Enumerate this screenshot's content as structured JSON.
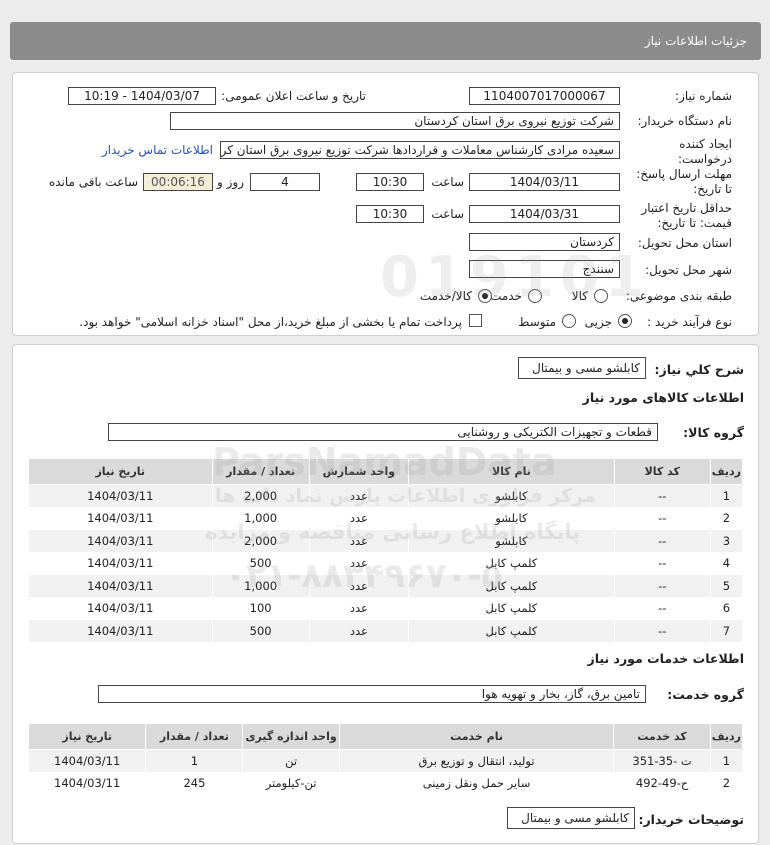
{
  "header": {
    "title": "جزئیات اطلاعات نیاز"
  },
  "form": {
    "need_number_label": "شماره نیاز:",
    "need_number": "1104007017000067",
    "announce_label": "تاریخ و ساعت اعلان عمومی:",
    "announce_value": "1404/03/07 - 10:19",
    "buyer_org_label": "نام دستگاه خریدار:",
    "buyer_org": "شرکت توزیع نیروی برق استان کردستان",
    "creator_label_1": "ایجاد کننده",
    "creator_label_2": "درخواست:",
    "creator": "سعیده مرادی کارشناس معاملات و قراردادها شرکت توزیع نیروی برق استان کرد",
    "contact_link": "اطلاعات تماس خریدار",
    "deadline_label_1": "مهلت ارسال پاسخ:",
    "deadline_label_2": "تا تاریخ:",
    "deadline_date": "1404/03/11",
    "time_label": "ساعت",
    "deadline_time": "10:30",
    "days": "4",
    "days_label": "روز و",
    "remaining": "00:06:16",
    "remaining_label": "ساعت باقی مانده",
    "validity_label_1": "حداقل تاریخ اعتبار",
    "validity_label_2": "قیمت: تا تاریخ:",
    "validity_date": "1404/03/31",
    "validity_time": "10:30",
    "province_label": "استان محل تحویل:",
    "province": "کردستان",
    "city_label": "شهر محل تحویل:",
    "city": "سنندج",
    "category_label": "طبقه بندی موضوعی:",
    "cat_goods": "کالا",
    "cat_service": "خدمت",
    "cat_both": "کالا/خدمت",
    "process_label": "نوع فرآیند خرید :",
    "proc_partial": "جزیی",
    "proc_medium": "متوسط",
    "payment_note": "پرداخت تمام یا بخشی از مبلغ خرید،از محل \"اسناد خزانه اسلامی\" خواهد بود."
  },
  "summary": {
    "label": "شرح کلي نياز:",
    "value": "کابلشو مسی و بیمتال"
  },
  "goods": {
    "section_title": "اطلاعات کالاهای مورد نیاز",
    "group_label": "گروه کالا:",
    "group_value": "قطعات و تجهیزات الکتریکی و روشنایی",
    "headers": [
      "ردیف",
      "کد کالا",
      "نام کالا",
      "واحد شمارش",
      "تعداد / مقدار",
      "تاریخ نیاز"
    ],
    "rows": [
      [
        "1",
        "--",
        "کابلشو",
        "عدد",
        "2,000",
        "1404/03/11"
      ],
      [
        "2",
        "--",
        "کابلشو",
        "عدد",
        "1,000",
        "1404/03/11"
      ],
      [
        "3",
        "--",
        "کابلشو",
        "عدد",
        "2,000",
        "1404/03/11"
      ],
      [
        "4",
        "--",
        "کلمپ کابل",
        "عدد",
        "500",
        "1404/03/11"
      ],
      [
        "5",
        "--",
        "کلمپ کابل",
        "عدد",
        "1,000",
        "1404/03/11"
      ],
      [
        "6",
        "--",
        "کلمپ کابل",
        "عدد",
        "100",
        "1404/03/11"
      ],
      [
        "7",
        "--",
        "کلمپ کابل",
        "عدد",
        "500",
        "1404/03/11"
      ]
    ]
  },
  "services": {
    "section_title": "اطلاعات خدمات مورد نیاز",
    "group_label": "گروه خدمت:",
    "group_value": "تامین برق، گاز، بخار و تهویه هوا",
    "headers": [
      "ردیف",
      "کد خدمت",
      "نام خدمت",
      "واحد اندازه گیری",
      "تعداد / مقدار",
      "تاریخ نیاز"
    ],
    "rows": [
      [
        "1",
        "ت -35-351",
        "تولید، انتقال و توزیع برق",
        "تن",
        "1",
        "1404/03/11"
      ],
      [
        "2",
        "ح-49-492",
        "سایر حمل ونقل زمینی",
        "تن-کیلومتر",
        "245",
        "1404/03/11"
      ]
    ]
  },
  "buyer_notes": {
    "label": "توضیحات خریدار:",
    "value": "کابلشو مسی و بیمتال"
  },
  "watermark": {
    "brand": "ParsNamadData",
    "line1": "مرکز فراوری اطلاعات پارس نماد داده ها",
    "line2": "پایگاه اطلاع رسانی مناقصه و مزایده",
    "phone": "۰۲۱-۸۸۳۴۹۶۷۰-۵",
    "digits": "019101"
  }
}
